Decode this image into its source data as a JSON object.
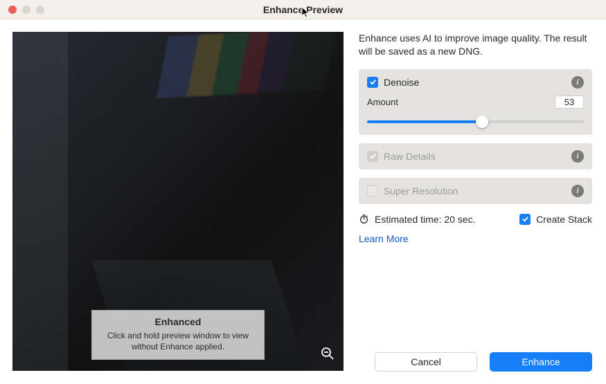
{
  "window": {
    "title": "Enhance Preview"
  },
  "description": "Enhance uses AI to improve image quality. The result will be saved as a new DNG.",
  "denoise": {
    "label": "Denoise",
    "checked": true,
    "amount_label": "Amount",
    "amount_value": "53",
    "amount_percent": 53
  },
  "raw_details": {
    "label": "Raw Details",
    "checked": true,
    "disabled": true
  },
  "super_res": {
    "label": "Super Resolution",
    "checked": false,
    "disabled": true
  },
  "estimated_time": "Estimated time: 20 sec.",
  "create_stack": {
    "label": "Create Stack",
    "checked": true
  },
  "learn_more": "Learn More",
  "buttons": {
    "cancel": "Cancel",
    "enhance": "Enhance"
  },
  "preview_tooltip": {
    "title": "Enhanced",
    "body": "Click and hold preview window to view without Enhance applied."
  }
}
